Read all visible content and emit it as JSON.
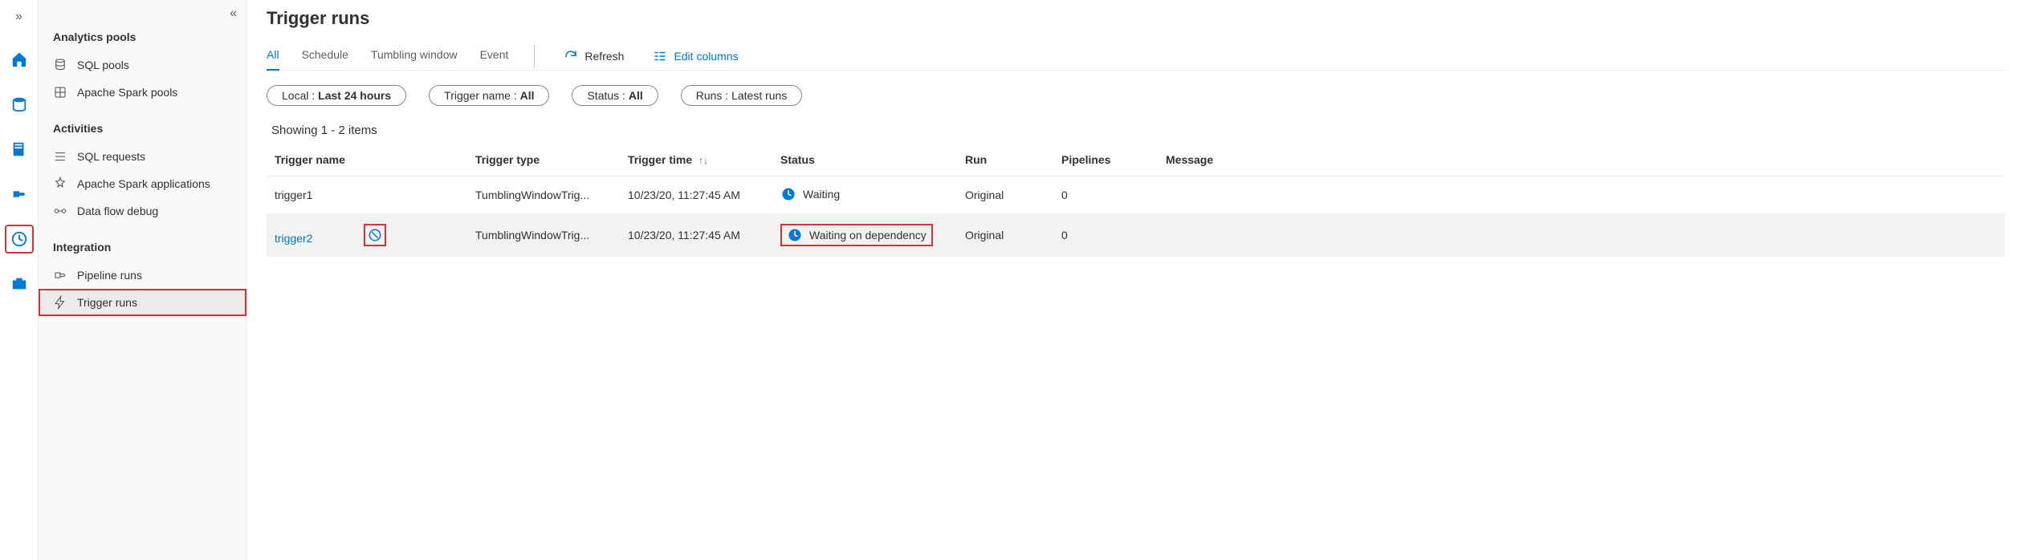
{
  "rail": {
    "expand_glyph": "»"
  },
  "sidebar": {
    "collapse_glyph": "«",
    "sections": [
      {
        "header": "Analytics pools",
        "items": [
          "SQL pools",
          "Apache Spark pools"
        ]
      },
      {
        "header": "Activities",
        "items": [
          "SQL requests",
          "Apache Spark applications",
          "Data flow debug"
        ]
      },
      {
        "header": "Integration",
        "items": [
          "Pipeline runs",
          "Trigger runs"
        ]
      }
    ]
  },
  "page": {
    "title": "Trigger runs",
    "tabs": [
      "All",
      "Schedule",
      "Tumbling window",
      "Event"
    ],
    "active_tab": "All",
    "actions": {
      "refresh": "Refresh",
      "edit_columns": "Edit columns"
    },
    "filters": {
      "local_label": "Local :",
      "local_value": "Last 24 hours",
      "trigger_name_label": "Trigger name :",
      "trigger_name_value": "All",
      "status_label": "Status :",
      "status_value": "All",
      "runs_label": "Runs :",
      "runs_value": "Latest runs"
    },
    "showing_text": "Showing 1 - 2 items",
    "columns": [
      "Trigger name",
      "Trigger type",
      "Trigger time",
      "Status",
      "Run",
      "Pipelines",
      "Message"
    ],
    "rows": [
      {
        "name": "trigger1",
        "type": "TumblingWindowTrig...",
        "time": "10/23/20, 11:27:45 AM",
        "status": "Waiting",
        "run": "Original",
        "pipelines": "0",
        "message": ""
      },
      {
        "name": "trigger2",
        "type": "TumblingWindowTrig...",
        "time": "10/23/20, 11:27:45 AM",
        "status": "Waiting on dependency",
        "run": "Original",
        "pipelines": "0",
        "message": ""
      }
    ]
  }
}
